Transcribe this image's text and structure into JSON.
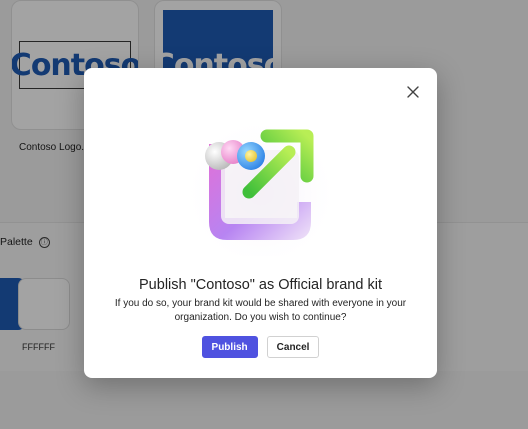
{
  "background": {
    "assets": [
      {
        "logo_text": "Contoso",
        "name": "Contoso Logo.png"
      },
      {
        "logo_text": "Contoso"
      }
    ],
    "palette": {
      "title": "Palette",
      "info_icon": "ⓘ",
      "swatches": [
        {
          "color": "#1F5BB5"
        },
        {
          "color": "#FFFFFF",
          "label": "FFFFFF"
        }
      ]
    }
  },
  "dialog": {
    "close_icon": "close-icon",
    "hero_illustration": "publish-brand-kit-illustration",
    "title": "Publish \"Contoso\" as Official brand kit",
    "body": "If you do so, your brand kit would be shared with everyone in your organization. Do you wish to continue?",
    "primary_button": "Publish",
    "secondary_button": "Cancel",
    "accent_color": "#4F52E0"
  }
}
